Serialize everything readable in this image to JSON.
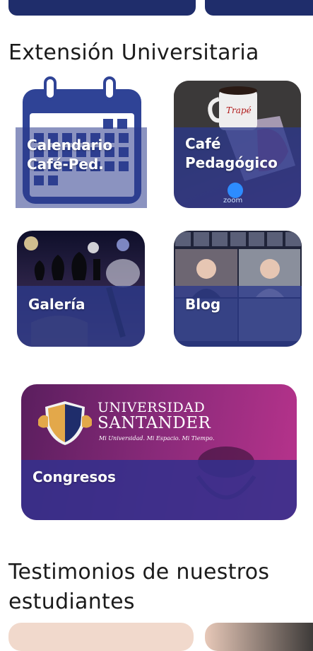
{
  "section_extension": {
    "title": "Extensión Universitaria"
  },
  "tiles": [
    {
      "label_line1": "Calendario",
      "label_line2": "Café-Ped."
    },
    {
      "label_line1": "Café",
      "label_line2": "Pedagógico",
      "badge": "zoom",
      "mug_text": "Trapé"
    },
    {
      "label": "Galería"
    },
    {
      "label": "Blog"
    },
    {
      "label": "Congresos"
    }
  ],
  "congresos_logo": {
    "line1": "UNIVERSIDAD",
    "line2": "SANTANDER",
    "tagline": "Mi Universidad. Mi Espacio. Mi Tiempo."
  },
  "section_testimonials": {
    "title_line1": "Testimonios de nuestros",
    "title_line2": "estudiantes"
  },
  "colors": {
    "brand_navy": "#1f2d6b",
    "band_blue": "#2c3a8c",
    "congress_magenta": "#a0287a"
  }
}
